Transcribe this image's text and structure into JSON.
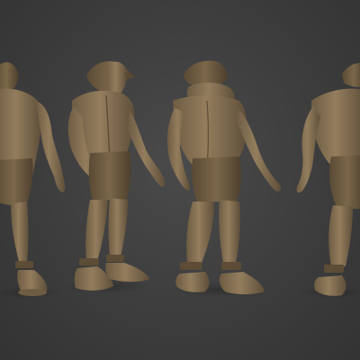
{
  "scene": {
    "subject": "sculpted-character-turnaround",
    "background_color": "#3d3d3d",
    "clay_color": "#8a7558",
    "clay_shadow": "#5e4e38",
    "clay_highlight": "#a89070",
    "views": [
      {
        "id": "front-view-cropped"
      },
      {
        "id": "three-quarter-front-view"
      },
      {
        "id": "back-view"
      },
      {
        "id": "three-quarter-back-view-cropped"
      }
    ]
  }
}
